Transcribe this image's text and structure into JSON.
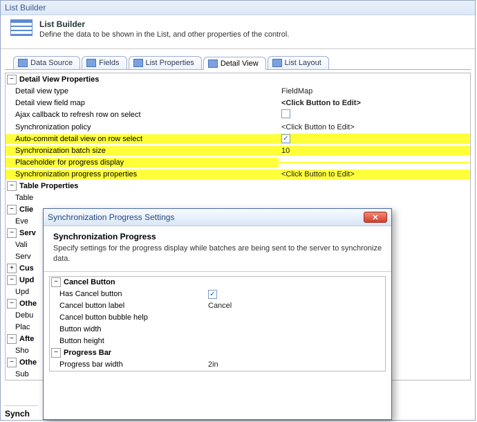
{
  "window_title": "List Builder",
  "header": {
    "title": "List Builder",
    "subtitle": "Define the data to be shown in the List, and other properties of the control."
  },
  "tabs": [
    {
      "label": "Data Source"
    },
    {
      "label": "Fields"
    },
    {
      "label": "List Properties"
    },
    {
      "label": "Detail View",
      "active": true
    },
    {
      "label": "List Layout"
    }
  ],
  "propgrid": {
    "cat1": "Detail View Properties",
    "r1": {
      "label": "Detail view type",
      "value": "FieldMap"
    },
    "r2": {
      "label": "Detail view field map",
      "value": "<Click Button to Edit>"
    },
    "r3": {
      "label": "Ajax callback to refresh row on select",
      "checked": false
    },
    "r4": {
      "label": "Synchronization policy",
      "value": "<Click Button to Edit>"
    },
    "r5": {
      "label": "Auto-commit detail view on row select",
      "checked": true
    },
    "r6": {
      "label": "Synchronization batch size",
      "value": "10"
    },
    "r7": {
      "label": "Placeholder for progress display",
      "value": ""
    },
    "r8": {
      "label": "Synchronization progress properties",
      "value": "<Click Button to Edit>"
    },
    "cat2": "Table Properties",
    "r9": {
      "label": "Table"
    },
    "cat3": "Clie",
    "r10": {
      "label": "Eve"
    },
    "cat4": "Serv",
    "r11": {
      "label": "Vali"
    },
    "r12": {
      "label": "Serv"
    },
    "cat5": "Cus",
    "cat6": "Upd",
    "r13": {
      "label": "Upd"
    },
    "cat7": "Othe",
    "r14": {
      "label": "Debu"
    },
    "r15": {
      "label": "Plac"
    },
    "cat8": "Afte",
    "r16": {
      "label": "Sho"
    },
    "cat9": "Othe",
    "r17": {
      "label": "Sub"
    }
  },
  "dialog": {
    "title": "Synchronization Progress Settings",
    "head_title": "Synchronization Progress",
    "head_sub": "Specify settings for the progress display while batches are being sent to the server to synchronize data.",
    "cat1": "Cancel Button",
    "r1": {
      "label": "Has Cancel button",
      "checked": true
    },
    "r2": {
      "label": "Cancel button label",
      "value": "Cancel"
    },
    "r3": {
      "label": "Cancel button bubble help",
      "value": ""
    },
    "r4": {
      "label": "Button width",
      "value": ""
    },
    "r5": {
      "label": "Button height",
      "value": ""
    },
    "cat2": "Progress Bar",
    "r6": {
      "label": "Progress bar width",
      "value": "2in"
    }
  },
  "footer_stub": "Synch"
}
